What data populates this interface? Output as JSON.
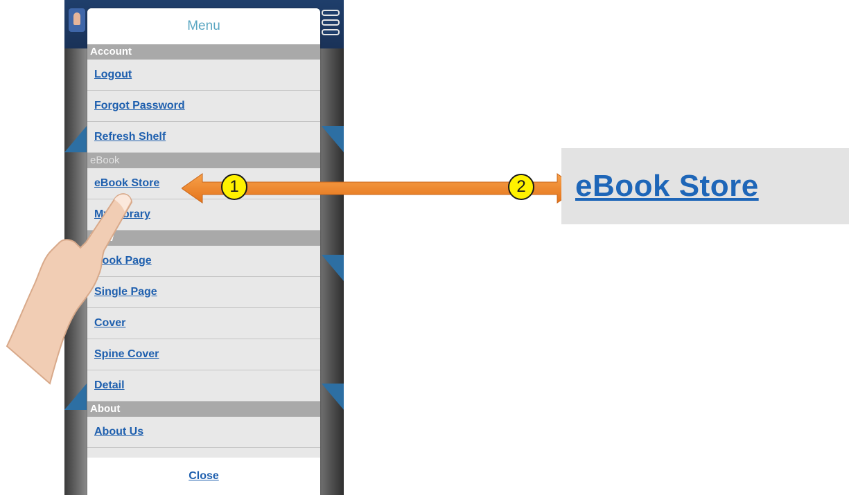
{
  "menu": {
    "title": "Menu",
    "sections": [
      {
        "label": "Account",
        "items": [
          "Logout",
          "Forgot Password",
          "Refresh Shelf"
        ]
      },
      {
        "label": "eBook",
        "items": [
          "eBook Store",
          "My Library"
        ]
      },
      {
        "label": "View",
        "items": [
          "Book Page",
          "Single Page",
          "Cover",
          "Spine Cover",
          "Detail"
        ]
      },
      {
        "label": "About",
        "items": [
          "About Us"
        ]
      }
    ],
    "close_label": "Close"
  },
  "annotations": {
    "step1": "1",
    "step2": "2",
    "zoom_label": "eBook Store",
    "arrow_color": "#f28a1e",
    "badge_color": "#fff200"
  },
  "colors": {
    "link": "#1e5fae",
    "section_bg": "#a9a9a9",
    "menu_bg": "#e8e8e8",
    "title": "#5aa6c2",
    "phone_header": "#1f3e6b"
  },
  "icons": [
    "app-logo-icon",
    "hamburger-icon",
    "finger-pointer-icon"
  ]
}
